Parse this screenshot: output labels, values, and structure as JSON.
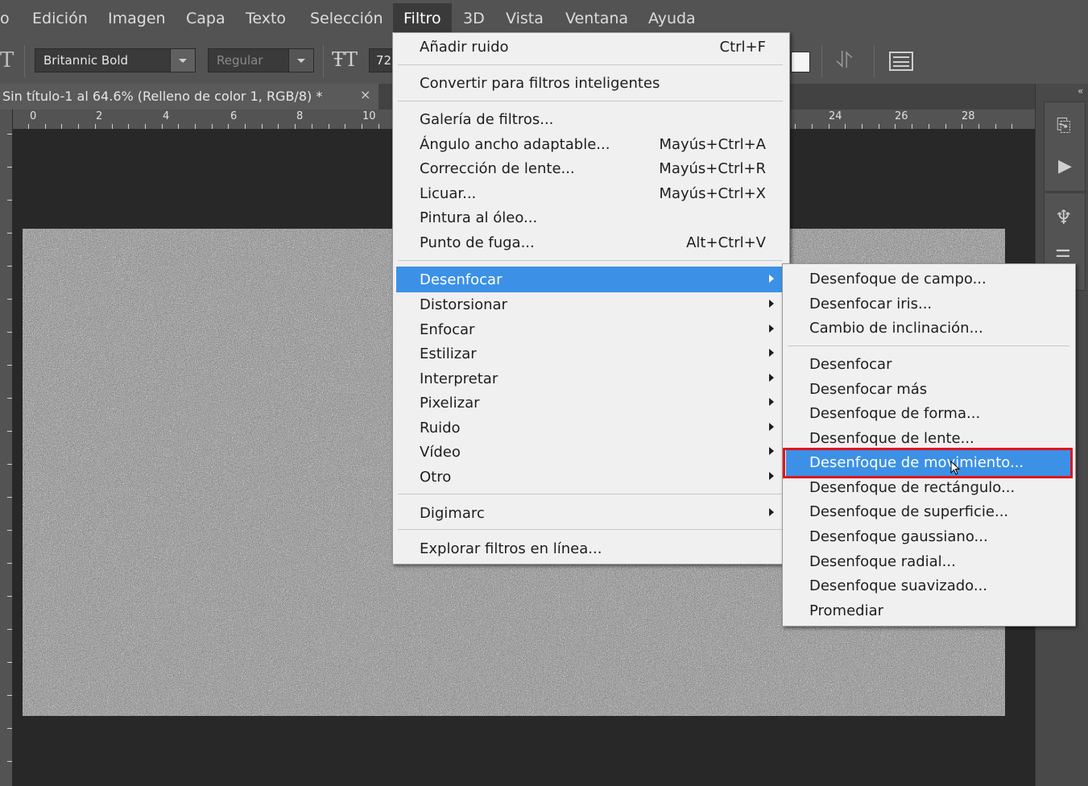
{
  "menubar": {
    "items": [
      "o",
      "Edición",
      "Imagen",
      "Capa",
      "Texto",
      "Selección",
      "Filtro",
      "3D",
      "Vista",
      "Ventana",
      "Ayuda"
    ],
    "active": "Filtro"
  },
  "options_bar": {
    "font_family": "Britannic Bold",
    "font_style": "Regular",
    "font_size": "72"
  },
  "document_tab": {
    "title": "Sin título-1 al 64.6% (Relleno de color 1, RGB/8) *",
    "close": "×"
  },
  "ruler": {
    "left_labels": [
      "0",
      "2",
      "4",
      "6",
      "8",
      "10"
    ],
    "right_labels": [
      "24",
      "26",
      "28"
    ]
  },
  "filter_menu": {
    "items": [
      {
        "label": "Añadir ruido",
        "shortcut": "Ctrl+F"
      },
      {
        "label": "Convertir para filtros inteligentes",
        "shortcut": ""
      },
      {
        "label": "Galería de filtros...",
        "shortcut": ""
      },
      {
        "label": "Ángulo ancho adaptable...",
        "shortcut": "Mayús+Ctrl+A"
      },
      {
        "label": "Corrección de lente...",
        "shortcut": "Mayús+Ctrl+R"
      },
      {
        "label": "Licuar...",
        "shortcut": "Mayús+Ctrl+X"
      },
      {
        "label": "Pintura al óleo...",
        "shortcut": ""
      },
      {
        "label": "Punto de fuga...",
        "shortcut": "Alt+Ctrl+V"
      },
      {
        "label": "Desenfocar",
        "submenu": true,
        "highlighted": true
      },
      {
        "label": "Distorsionar",
        "submenu": true
      },
      {
        "label": "Enfocar",
        "submenu": true
      },
      {
        "label": "Estilizar",
        "submenu": true
      },
      {
        "label": "Interpretar",
        "submenu": true
      },
      {
        "label": "Pixelizar",
        "submenu": true
      },
      {
        "label": "Ruido",
        "submenu": true
      },
      {
        "label": "Vídeo",
        "submenu": true
      },
      {
        "label": "Otro",
        "submenu": true
      },
      {
        "label": "Digimarc",
        "submenu": true
      },
      {
        "label": "Explorar filtros en línea..."
      }
    ]
  },
  "blur_submenu": {
    "items": [
      "Desenfoque de campo...",
      "Desenfocar iris...",
      "Cambio de inclinación...",
      "Desenfocar",
      "Desenfocar más",
      "Desenfoque de forma...",
      "Desenfoque de lente...",
      "Desenfoque de movimiento...",
      "Desenfoque de rectángulo...",
      "Desenfoque de superficie...",
      "Desenfoque gaussiano...",
      "Desenfoque radial...",
      "Desenfoque suavizado...",
      "Promediar"
    ],
    "highlighted": "Desenfoque de movimiento..."
  },
  "colors": {
    "menu_bg": "#f0f0f0",
    "highlight": "#3c91e6",
    "annotation_red": "#e0141e",
    "ui_gray": "#535353"
  }
}
